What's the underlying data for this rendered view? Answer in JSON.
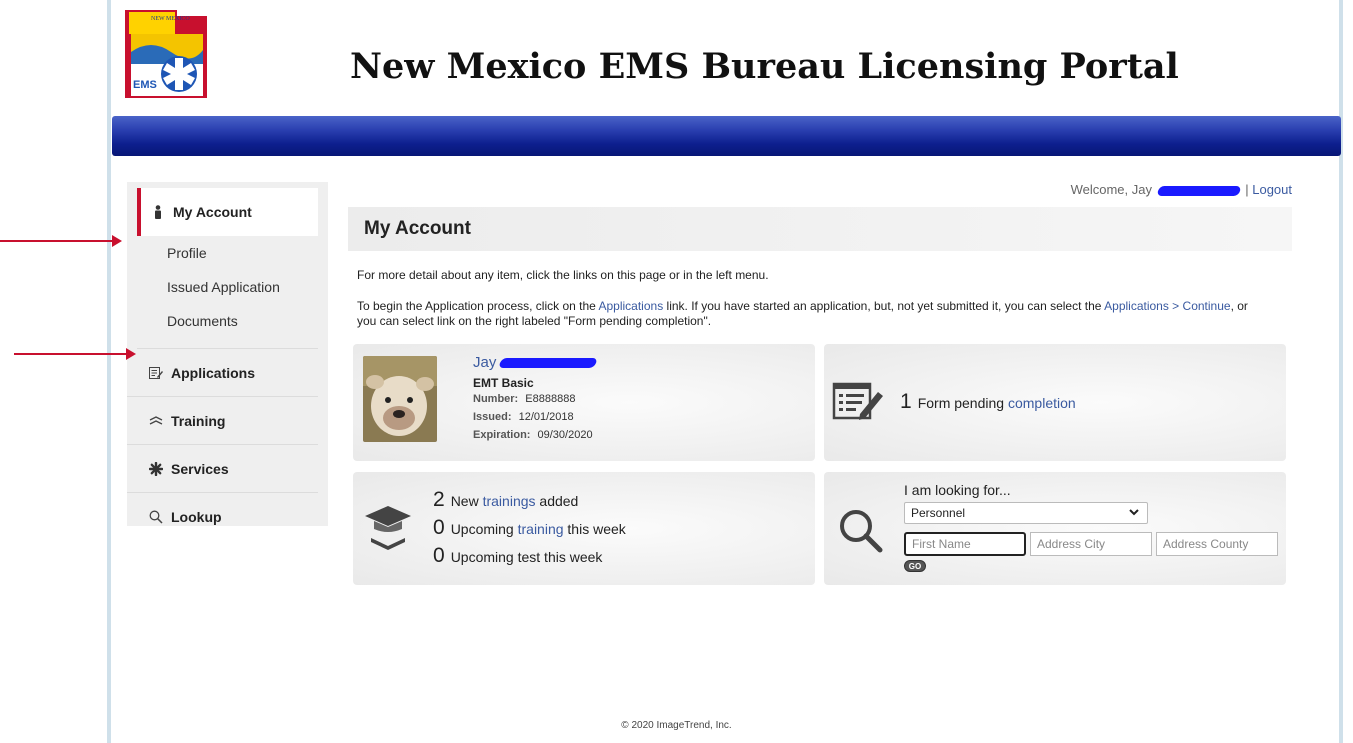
{
  "header": {
    "title": "New Mexico EMS Bureau Licensing Portal",
    "logo_top_text": "NEW MEXICO",
    "logo_bottom_text": "EMS"
  },
  "welcome": {
    "prefix": "Welcome, Jay",
    "separator": "|",
    "logout": "Logout"
  },
  "sidebar": {
    "account_label": "My Account",
    "sub_items": [
      "Profile",
      "Issued Application",
      "Documents"
    ],
    "items": [
      {
        "label": "Applications",
        "icon": "applications-icon"
      },
      {
        "label": "Training",
        "icon": "training-icon"
      },
      {
        "label": "Services",
        "icon": "services-icon"
      },
      {
        "label": "Lookup",
        "icon": "search-icon"
      }
    ]
  },
  "main": {
    "title": "My Account",
    "intro1": "For more detail about any item, click the links on this page or in the left menu.",
    "intro2_a": "To begin the Application process, click on the ",
    "intro2_link1": "Applications",
    "intro2_b": " link. If you have started an application, but, not yet submitted it, you can select the ",
    "intro2_link2": "Applications > Continue",
    "intro2_c": ", or you can select link on the right labeled \"Form pending completion\"."
  },
  "profile_card": {
    "name": "Jay",
    "level": "EMT Basic",
    "number_label": "Number:",
    "number": "E8888888",
    "issued_label": "Issued:",
    "issued": "12/01/2018",
    "expiration_label": "Expiration:",
    "expiration": "09/30/2020"
  },
  "forms_card": {
    "count": "1",
    "text": "Form pending",
    "link": "completion"
  },
  "training_card": {
    "new_count": "2",
    "new_text_a": "New",
    "new_link": "trainings",
    "new_text_b": "added",
    "upcoming_count": "0",
    "upcoming_a": "Upcoming",
    "upcoming_link": "training",
    "upcoming_b": "this week",
    "test_count": "0",
    "test_text": "Upcoming test this week"
  },
  "lookup_card": {
    "label": "I am looking for...",
    "selected": "Personnel",
    "first_name_placeholder": "First Name",
    "city_placeholder": "Address City",
    "county_placeholder": "Address County",
    "go": "GO"
  },
  "footer": {
    "text": "© 2020 ImageTrend, Inc."
  },
  "colors": {
    "accent_red": "#c8102e",
    "link_blue": "#3a5aa0",
    "band_blue": "#0d1f8e"
  }
}
